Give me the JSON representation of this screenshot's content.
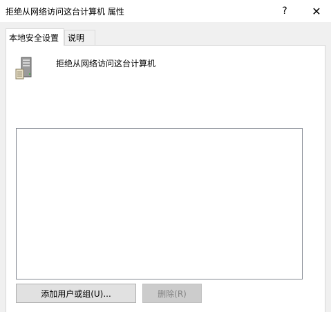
{
  "window": {
    "title": "拒绝从网络访问这台计算机 属性",
    "help_glyph": "?",
    "close_glyph": "✕"
  },
  "tabs": [
    {
      "label": "本地安全设置",
      "active": true
    },
    {
      "label": "说明",
      "active": false
    }
  ],
  "policy": {
    "icon": "server-icon",
    "name": "拒绝从网络访问这台计算机"
  },
  "list": {
    "items": []
  },
  "buttons": {
    "add_label": "添加用户或组(U)...",
    "remove_label": "删除(R)",
    "remove_enabled": false
  }
}
